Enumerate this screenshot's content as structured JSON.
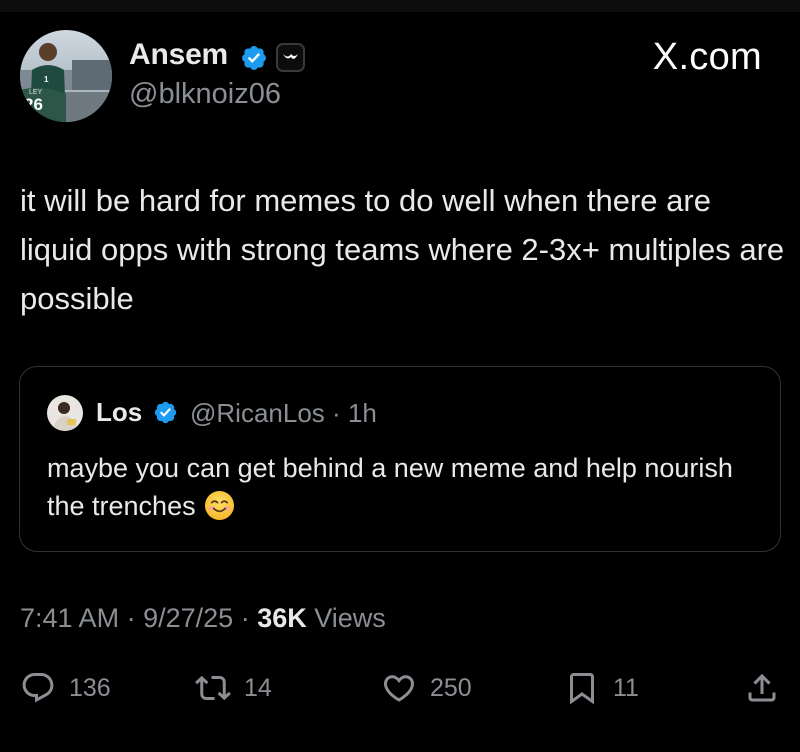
{
  "author": {
    "name": "Ansem",
    "handle": "@blknoiz06",
    "avatar_jersey_number": "26",
    "avatar_jersey_name": "LEY"
  },
  "site_logo": "X.com",
  "tweet": {
    "text": "it will be hard for memes to do well when there are liquid opps with strong teams where 2-3x+ multiples are possible"
  },
  "quote": {
    "name": "Los",
    "handle": "@RicanLos",
    "separator": "·",
    "time": "1h",
    "text": "maybe you can get behind a new meme and help nourish the trenches",
    "emoji": "smiling-face-emoji"
  },
  "meta": {
    "time": "7:41 AM",
    "sep1": "·",
    "date": "9/27/25",
    "sep2": "·",
    "views_count": "36K",
    "views_label": "Views"
  },
  "actions": {
    "replies": "136",
    "reposts": "14",
    "likes": "250",
    "bookmarks": "11"
  },
  "icons": [
    "verified-icon",
    "affiliate-badge-icon",
    "reply-icon",
    "repost-icon",
    "like-icon",
    "bookmark-icon",
    "share-icon"
  ],
  "colors": {
    "background": "#000000",
    "text": "#e7e9ea",
    "secondary_text": "#8b8f94",
    "verified_blue": "#1d9bf0",
    "border": "#2f3336"
  }
}
